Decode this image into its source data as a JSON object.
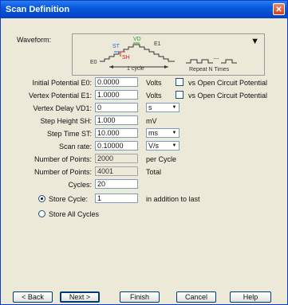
{
  "window": {
    "title": "Scan Definition",
    "close_symbol": "✕"
  },
  "waveform": {
    "label": "Waveform:",
    "diagram": {
      "st": "ST",
      "vd": "VD",
      "e1": "E1",
      "e0": "E0",
      "sh": "SH",
      "cycle": "1 cycle",
      "repeat": "Repeat N Times",
      "ellipsis": "..."
    }
  },
  "fields": {
    "initial_potential": {
      "label": "Initial Potential E0:",
      "value": "0.0000",
      "unit": "Volts",
      "check_label": "vs Open Circuit Potential"
    },
    "vertex_potential": {
      "label": "Vertex Potential E1:",
      "value": "1.0000",
      "unit": "Volts",
      "check_label": "vs Open Circuit Potential"
    },
    "vertex_delay": {
      "label": "Vertex Delay VD1:",
      "value": "0",
      "unit": "s"
    },
    "step_height": {
      "label": "Step Height SH:",
      "value": "1.000",
      "unit": "mV"
    },
    "step_time": {
      "label": "Step Time ST:",
      "value": "10.000",
      "unit": "ms"
    },
    "scan_rate": {
      "label": "Scan rate:",
      "value": "0.10000",
      "unit": "V/s"
    },
    "points_per_cycle": {
      "label": "Number of Points:",
      "value": "2000",
      "suffix": "per Cycle"
    },
    "points_total": {
      "label": "Number of Points:",
      "value": "4001",
      "suffix": "Total"
    },
    "cycles": {
      "label": "Cycles:",
      "value": "20"
    }
  },
  "store": {
    "store_cycle_label": "Store Cycle:",
    "store_cycle_value": "1",
    "store_cycle_suffix": "in addition to last",
    "store_all_label": "Store All Cycles",
    "selected": "store_cycle"
  },
  "buttons": {
    "back": "< Back",
    "next": "Next >",
    "finish": "Finish",
    "cancel": "Cancel",
    "help": "Help"
  }
}
